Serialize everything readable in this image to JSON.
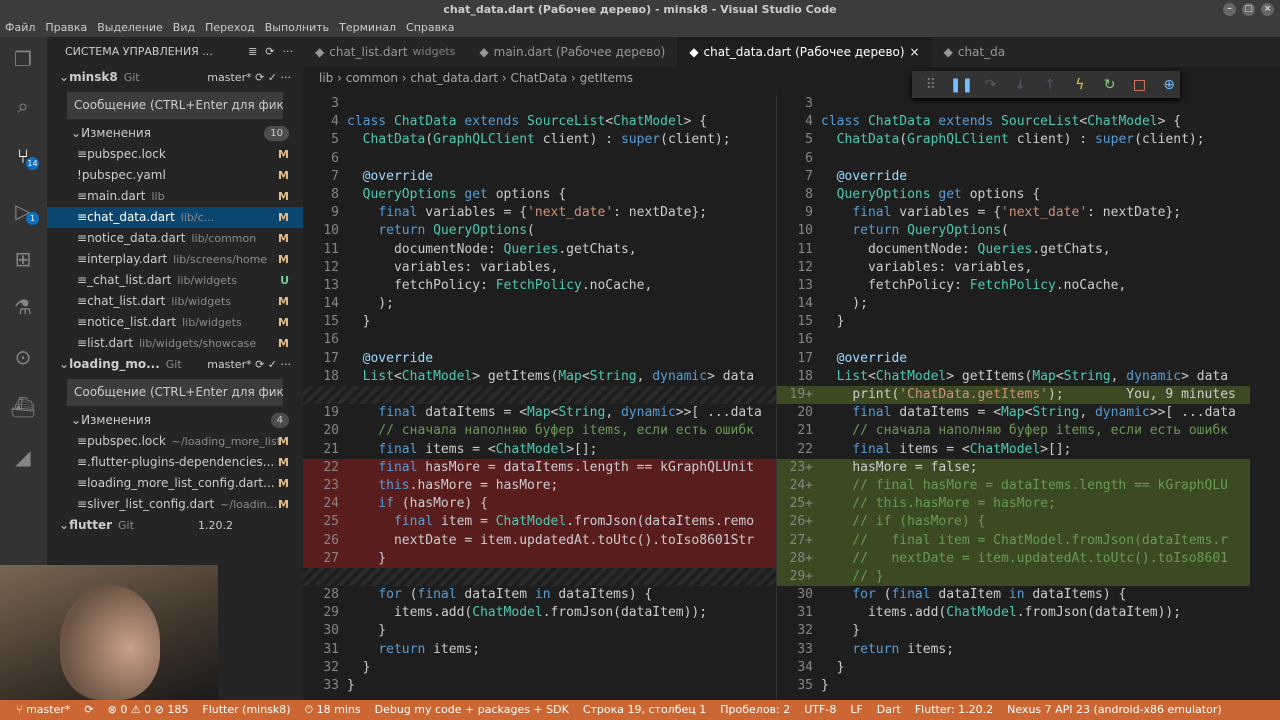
{
  "title": "chat_data.dart (Рабочее дерево) - minsk8 - Visual Studio Code",
  "menu": [
    "Файл",
    "Правка",
    "Выделение",
    "Вид",
    "Переход",
    "Выполнить",
    "Терминал",
    "Справка"
  ],
  "sidebar": {
    "header": "СИСТЕМА УПРАВЛЕНИЯ ...",
    "repo1": {
      "name": "minsk8",
      "scm": "Git",
      "branch": "master*",
      "msg": "Сообщение (CTRL+Enter для фикс...",
      "changes_label": "Изменения",
      "changes_count": "10",
      "files": [
        {
          "name": "pubspec.lock",
          "dir": "",
          "status": "M",
          "icon": "≡"
        },
        {
          "name": "pubspec.yaml",
          "dir": "",
          "status": "M",
          "icon": "!"
        },
        {
          "name": "main.dart",
          "dir": "lib",
          "status": "M",
          "icon": "≡"
        },
        {
          "name": "chat_data.dart",
          "dir": "lib/c...",
          "status": "M",
          "icon": "≡"
        },
        {
          "name": "notice_data.dart",
          "dir": "lib/common",
          "status": "M",
          "icon": "≡"
        },
        {
          "name": "interplay.dart",
          "dir": "lib/screens/home",
          "status": "M",
          "icon": "≡"
        },
        {
          "name": "_chat_list.dart",
          "dir": "lib/widgets",
          "status": "U",
          "icon": "≡"
        },
        {
          "name": "chat_list.dart",
          "dir": "lib/widgets",
          "status": "M",
          "icon": "≡"
        },
        {
          "name": "notice_list.dart",
          "dir": "lib/widgets",
          "status": "M",
          "icon": "≡"
        },
        {
          "name": "list.dart",
          "dir": "lib/widgets/showcase",
          "status": "M",
          "icon": "≡"
        }
      ]
    },
    "repo2": {
      "name": "loading_mo...",
      "scm": "Git",
      "branch": "master*",
      "msg": "Сообщение (CTRL+Enter для фикс...",
      "changes_label": "Изменения",
      "changes_count": "4",
      "files": [
        {
          "name": "pubspec.lock",
          "dir": "~/loading_more_list",
          "status": "M",
          "icon": "≡"
        },
        {
          "name": ".flutter-plugins-dependencies...",
          "dir": "",
          "status": "M",
          "icon": "≡"
        },
        {
          "name": "loading_more_list_config.dart...",
          "dir": "",
          "status": "M",
          "icon": "≡"
        },
        {
          "name": "sliver_list_config.dart",
          "dir": "~/loadin...",
          "status": "M",
          "icon": "≡"
        }
      ]
    },
    "repo3": {
      "name": "flutter",
      "scm": "Git",
      "branch": "1.20.2"
    }
  },
  "tabs": [
    {
      "label": "chat_list.dart",
      "sub": "widgets",
      "active": false
    },
    {
      "label": "main.dart (Рабочее дерево)",
      "sub": "",
      "active": false
    },
    {
      "label": "chat_data.dart (Рабочее дерево)",
      "sub": "",
      "active": true
    },
    {
      "label": "chat_da",
      "sub": "",
      "active": false
    }
  ],
  "breadcrumbs": "lib › common › chat_data.dart › ChatData › getItems",
  "left": [
    {
      "n": "3",
      "t": "",
      "c": ""
    },
    {
      "n": "4",
      "t": "class ChatData extends SourceList<ChatModel> {",
      "c": ""
    },
    {
      "n": "5",
      "t": "  ChatData(GraphQLClient client) : super(client);",
      "c": ""
    },
    {
      "n": "6",
      "t": "",
      "c": ""
    },
    {
      "n": "7",
      "t": "  @override",
      "c": ""
    },
    {
      "n": "8",
      "t": "  QueryOptions get options {",
      "c": ""
    },
    {
      "n": "9",
      "t": "    final variables = {'next_date': nextDate};",
      "c": ""
    },
    {
      "n": "10",
      "t": "    return QueryOptions(",
      "c": ""
    },
    {
      "n": "11",
      "t": "      documentNode: Queries.getChats,",
      "c": ""
    },
    {
      "n": "12",
      "t": "      variables: variables,",
      "c": ""
    },
    {
      "n": "13",
      "t": "      fetchPolicy: FetchPolicy.noCache,",
      "c": ""
    },
    {
      "n": "14",
      "t": "    );",
      "c": ""
    },
    {
      "n": "15",
      "t": "  }",
      "c": ""
    },
    {
      "n": "16",
      "t": "",
      "c": ""
    },
    {
      "n": "17",
      "t": "  @override",
      "c": ""
    },
    {
      "n": "18",
      "t": "  List<ChatModel> getItems(Map<String, dynamic> data",
      "c": ""
    },
    {
      "n": "",
      "t": "",
      "c": "gap"
    },
    {
      "n": "19",
      "t": "    final dataItems = <Map<String, dynamic>>[ ...data",
      "c": ""
    },
    {
      "n": "20",
      "t": "    // сначала наполняю буфер items, если есть ошибк",
      "c": ""
    },
    {
      "n": "21",
      "t": "    final items = <ChatModel>[];",
      "c": ""
    },
    {
      "n": "22",
      "t": "    final hasMore = dataItems.length == kGraphQLUnit",
      "c": "del"
    },
    {
      "n": "23",
      "t": "    this.hasMore = hasMore;",
      "c": "del"
    },
    {
      "n": "24",
      "t": "    if (hasMore) {",
      "c": "del"
    },
    {
      "n": "25",
      "t": "      final item = ChatModel.fromJson(dataItems.remo",
      "c": "del"
    },
    {
      "n": "26",
      "t": "      nextDate = item.updatedAt.toUtc().toIso8601Str",
      "c": "del"
    },
    {
      "n": "27",
      "t": "    }",
      "c": "del"
    },
    {
      "n": "",
      "t": "",
      "c": "gap"
    },
    {
      "n": "28",
      "t": "    for (final dataItem in dataItems) {",
      "c": ""
    },
    {
      "n": "29",
      "t": "      items.add(ChatModel.fromJson(dataItem));",
      "c": ""
    },
    {
      "n": "30",
      "t": "    }",
      "c": ""
    },
    {
      "n": "31",
      "t": "    return items;",
      "c": ""
    },
    {
      "n": "32",
      "t": "  }",
      "c": ""
    },
    {
      "n": "33",
      "t": "}",
      "c": ""
    }
  ],
  "right": [
    {
      "n": "3",
      "t": "",
      "c": ""
    },
    {
      "n": "4",
      "t": "class ChatData extends SourceList<ChatModel> {",
      "c": ""
    },
    {
      "n": "5",
      "t": "  ChatData(GraphQLClient client) : super(client);",
      "c": ""
    },
    {
      "n": "6",
      "t": "",
      "c": ""
    },
    {
      "n": "7",
      "t": "  @override",
      "c": ""
    },
    {
      "n": "8",
      "t": "  QueryOptions get options {",
      "c": ""
    },
    {
      "n": "9",
      "t": "    final variables = {'next_date': nextDate};",
      "c": ""
    },
    {
      "n": "10",
      "t": "    return QueryOptions(",
      "c": ""
    },
    {
      "n": "11",
      "t": "      documentNode: Queries.getChats,",
      "c": ""
    },
    {
      "n": "12",
      "t": "      variables: variables,",
      "c": ""
    },
    {
      "n": "13",
      "t": "      fetchPolicy: FetchPolicy.noCache,",
      "c": ""
    },
    {
      "n": "14",
      "t": "    );",
      "c": ""
    },
    {
      "n": "15",
      "t": "  }",
      "c": ""
    },
    {
      "n": "16",
      "t": "",
      "c": ""
    },
    {
      "n": "17",
      "t": "  @override",
      "c": ""
    },
    {
      "n": "18",
      "t": "  List<ChatModel> getItems(Map<String, dynamic> data",
      "c": ""
    },
    {
      "n": "19+",
      "t": "    print('ChatData.getItems');        You, 9 minutes",
      "c": "add"
    },
    {
      "n": "20",
      "t": "    final dataItems = <Map<String, dynamic>>[ ...data",
      "c": ""
    },
    {
      "n": "21",
      "t": "    // сначала наполняю буфер items, если есть ошибк",
      "c": ""
    },
    {
      "n": "22",
      "t": "    final items = <ChatModel>[];",
      "c": ""
    },
    {
      "n": "23+",
      "t": "    hasMore = false;",
      "c": "add"
    },
    {
      "n": "24+",
      "t": "    // final hasMore = dataItems.length == kGraphQLU",
      "c": "add"
    },
    {
      "n": "25+",
      "t": "    // this.hasMore = hasMore;",
      "c": "add"
    },
    {
      "n": "26+",
      "t": "    // if (hasMore) {",
      "c": "add"
    },
    {
      "n": "27+",
      "t": "    //   final item = ChatModel.fromJson(dataItems.r",
      "c": "add"
    },
    {
      "n": "28+",
      "t": "    //   nextDate = item.updatedAt.toUtc().toIso8601",
      "c": "add"
    },
    {
      "n": "29+",
      "t": "    // }",
      "c": "add"
    },
    {
      "n": "30",
      "t": "    for (final dataItem in dataItems) {",
      "c": ""
    },
    {
      "n": "31",
      "t": "      items.add(ChatModel.fromJson(dataItem));",
      "c": ""
    },
    {
      "n": "32",
      "t": "    }",
      "c": ""
    },
    {
      "n": "33",
      "t": "    return items;",
      "c": ""
    },
    {
      "n": "34",
      "t": "  }",
      "c": ""
    },
    {
      "n": "35",
      "t": "}",
      "c": ""
    }
  ],
  "status": [
    "⑂ master*",
    "⟳",
    "⊗ 0 ⚠ 0 ⊘ 185",
    "Flutter (minsk8)",
    "⏱ 18 mins",
    "Debug my code + packages + SDK",
    "Строка 19, столбец 1",
    "Пробелов: 2",
    "UTF-8",
    "LF",
    "Dart",
    "Flutter: 1.20.2",
    "Nexus 7 API 23 (android-x86 emulator)"
  ],
  "colors": {
    "status": "#cc6633",
    "accent": "#0e70c0"
  }
}
